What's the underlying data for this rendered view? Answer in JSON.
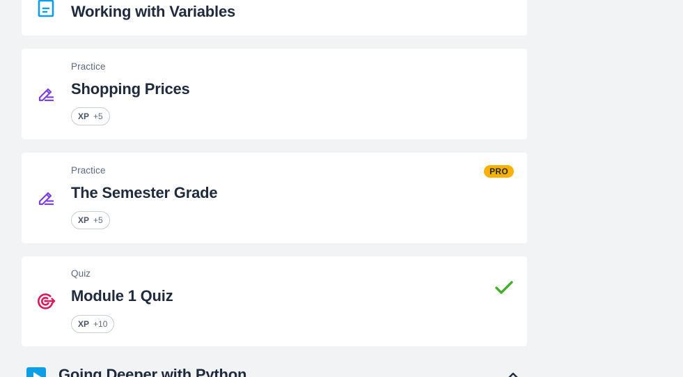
{
  "cards": [
    {
      "kind": "",
      "title": "Working with Variables",
      "icon": "document-icon"
    },
    {
      "kind": "Practice",
      "title": "Shopping Prices",
      "xp_label": "XP",
      "xp_value": "+5",
      "icon": "pencil-icon"
    },
    {
      "kind": "Practice",
      "title": "The Semester Grade",
      "xp_label": "XP",
      "xp_value": "+5",
      "badge": "PRO",
      "icon": "pencil-icon"
    },
    {
      "kind": "Quiz",
      "title": "Module 1 Quiz",
      "xp_label": "XP",
      "xp_value": "+10",
      "completed": true,
      "icon": "target-icon"
    }
  ],
  "section": {
    "title": "Going Deeper with Python",
    "icon": "play-icon",
    "expanded": true
  },
  "colors": {
    "background": "#f2f3f5",
    "card": "#ffffff",
    "title": "#1f2b3d",
    "practice_icon": "#7b3fe4",
    "quiz_icon": "#dc1a5a",
    "document_icon": "#0d9ee8",
    "pro_badge": "#fbb100",
    "check": "#43b02a"
  }
}
